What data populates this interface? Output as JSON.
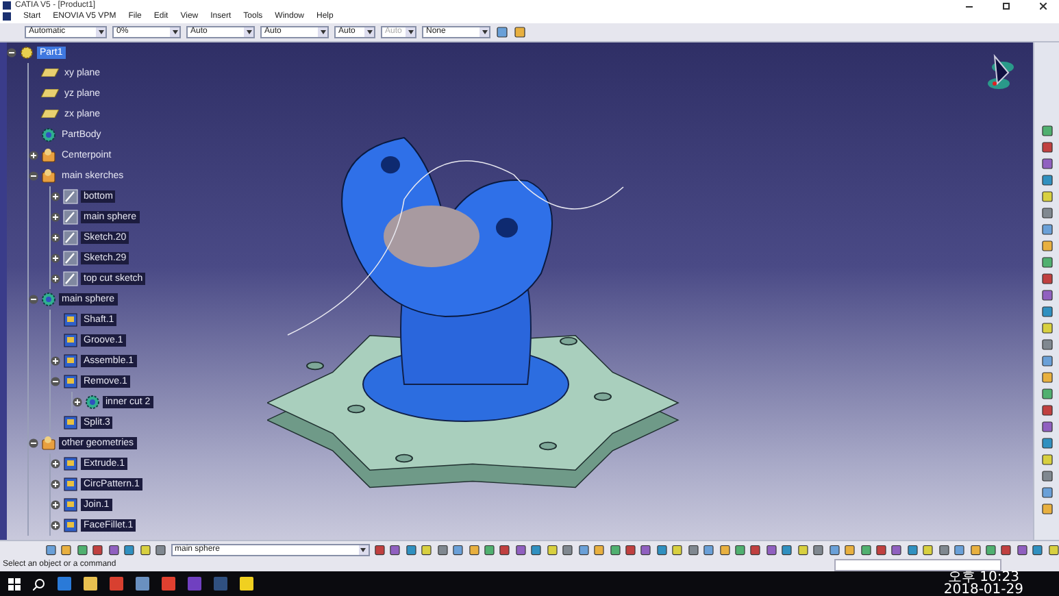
{
  "window": {
    "title": "CATIA V5 - [Product1]"
  },
  "menu": [
    {
      "label": "Start"
    },
    {
      "label": "ENOVIA V5 VPM"
    },
    {
      "label": "File"
    },
    {
      "label": "Edit"
    },
    {
      "label": "View"
    },
    {
      "label": "Insert"
    },
    {
      "label": "Tools"
    },
    {
      "label": "Window"
    },
    {
      "label": "Help"
    }
  ],
  "properties_toolbar": [
    {
      "value": "Automatic",
      "disabled": false
    },
    {
      "value": "0%",
      "disabled": false
    },
    {
      "value": "Auto",
      "disabled": false
    },
    {
      "value": "Auto",
      "disabled": false
    },
    {
      "value": "Auto",
      "disabled": false
    },
    {
      "value": "Auto",
      "disabled": true
    },
    {
      "value": "None",
      "disabled": false
    }
  ],
  "tree": [
    {
      "label": "Part1",
      "kind": "part",
      "expanded": true,
      "selected": true,
      "children": [
        {
          "label": "xy plane",
          "kind": "plane",
          "selected": false,
          "highlighted": false
        },
        {
          "label": "yz plane",
          "kind": "plane",
          "selected": false,
          "highlighted": false
        },
        {
          "label": "zx plane",
          "kind": "plane",
          "selected": false,
          "highlighted": false
        },
        {
          "label": "PartBody",
          "kind": "body",
          "selected": false,
          "highlighted": false
        },
        {
          "label": "Centerpoint",
          "kind": "set",
          "expanded": false,
          "selected": false,
          "highlighted": false
        },
        {
          "label": "main skerches",
          "kind": "set",
          "expanded": true,
          "selected": false,
          "highlighted": false,
          "children": [
            {
              "label": "bottom",
              "kind": "sketch",
              "expanded": false,
              "selected": false,
              "highlighted": true
            },
            {
              "label": "main sphere",
              "kind": "sketch",
              "expanded": false,
              "selected": false,
              "highlighted": true
            },
            {
              "label": "Sketch.20",
              "kind": "sketch",
              "expanded": false,
              "selected": false,
              "highlighted": true
            },
            {
              "label": "Sketch.29",
              "kind": "sketch",
              "expanded": false,
              "selected": false,
              "highlighted": true
            },
            {
              "label": "top cut sketch",
              "kind": "sketch",
              "expanded": false,
              "selected": false,
              "highlighted": true
            }
          ]
        },
        {
          "label": "main sphere",
          "kind": "body",
          "expanded": true,
          "selected": false,
          "highlighted": true,
          "children": [
            {
              "label": "Shaft.1",
              "kind": "feature",
              "selected": false,
              "highlighted": true
            },
            {
              "label": "Groove.1",
              "kind": "feature",
              "selected": false,
              "highlighted": true
            },
            {
              "label": "Assemble.1",
              "kind": "feature",
              "expanded": false,
              "selected": false,
              "highlighted": true
            },
            {
              "label": "Remove.1",
              "kind": "feature",
              "expanded": true,
              "selected": false,
              "highlighted": true,
              "children": [
                {
                  "label": "inner cut 2",
                  "kind": "body",
                  "expanded": false,
                  "selected": false,
                  "highlighted": true
                }
              ]
            },
            {
              "label": "Split.3",
              "kind": "feature",
              "selected": false,
              "highlighted": true
            }
          ]
        },
        {
          "label": "other geometries",
          "kind": "set",
          "expanded": true,
          "selected": false,
          "highlighted": true,
          "children": [
            {
              "label": "Extrude.1",
              "kind": "feature",
              "expanded": false,
              "selected": false,
              "highlighted": true
            },
            {
              "label": "CircPattern.1",
              "kind": "feature",
              "expanded": false,
              "selected": false,
              "highlighted": true
            },
            {
              "label": "Join.1",
              "kind": "feature",
              "expanded": false,
              "selected": false,
              "highlighted": true
            },
            {
              "label": "FaceFillet.1",
              "kind": "feature",
              "expanded": false,
              "selected": false,
              "highlighted": true
            }
          ]
        }
      ]
    }
  ],
  "bottom_toolbar": {
    "current_body": "main sphere"
  },
  "status_bar": {
    "message": "Select an object or a command"
  },
  "taskbar": {
    "time": "오후 10:23",
    "date": "2018-01-29"
  }
}
